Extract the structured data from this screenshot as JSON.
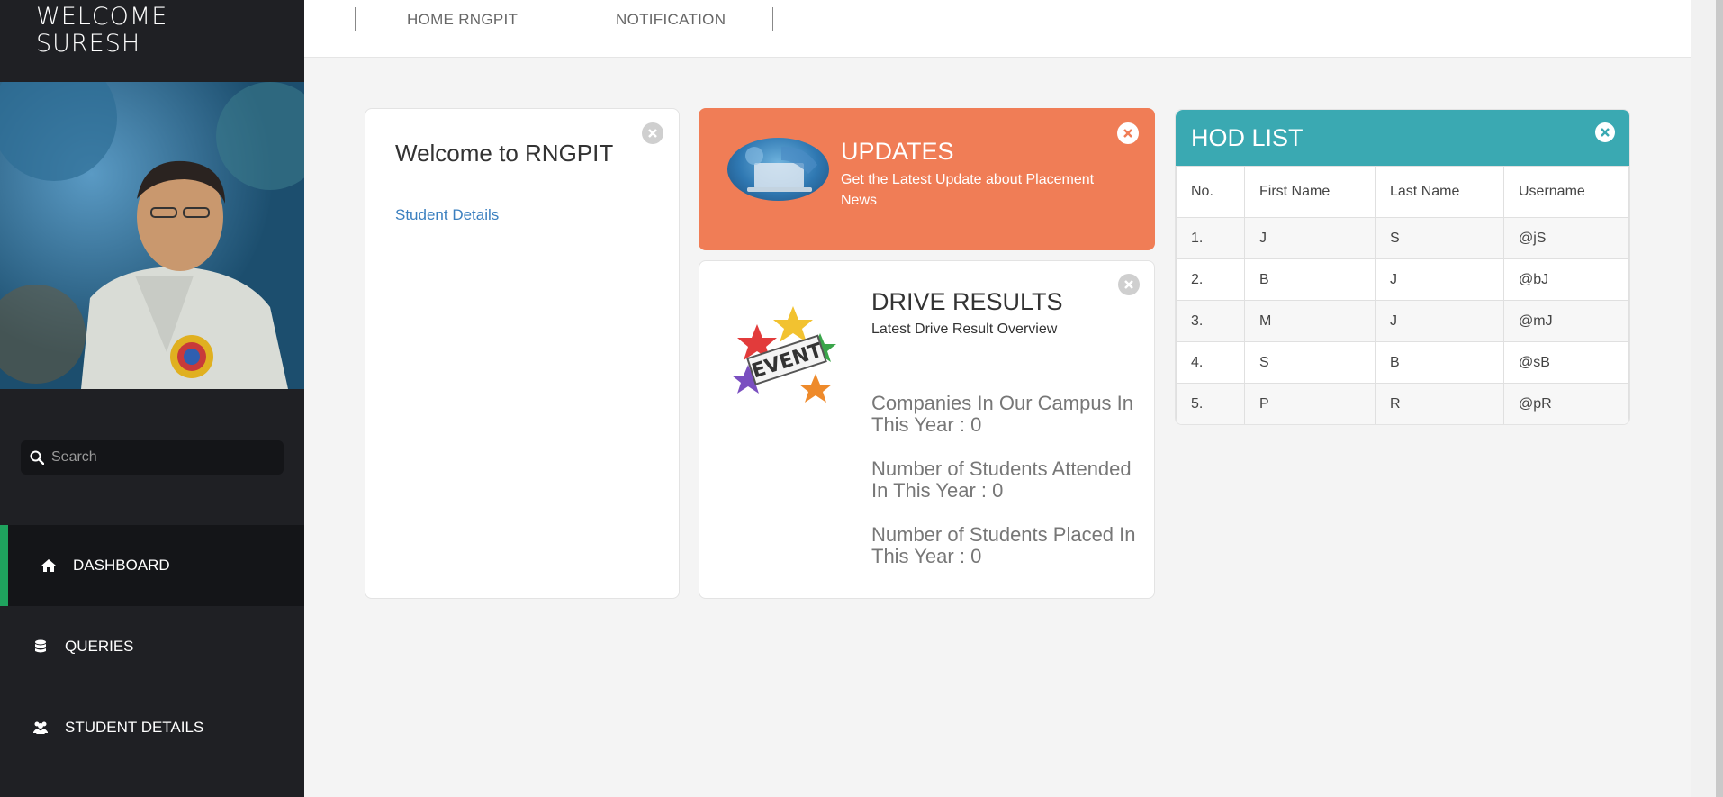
{
  "sidebar": {
    "welcome_line1": "WELCOME",
    "welcome_line2": "SURESH",
    "search": {
      "placeholder": "Search"
    },
    "nav": [
      {
        "label": "DASHBOARD",
        "icon": "home-icon",
        "active": true
      },
      {
        "label": "QUERIES",
        "icon": "database-icon",
        "active": false
      },
      {
        "label": "STUDENT DETAILS",
        "icon": "users-icon",
        "active": false
      }
    ]
  },
  "topbar": {
    "links": [
      "HOME RNGPIT",
      "NOTIFICATION"
    ]
  },
  "welcome_panel": {
    "title": "Welcome to RNGPIT",
    "link": "Student Details"
  },
  "updates_panel": {
    "title": "UPDATES",
    "subtitle": "Get the Latest Update about Placement News"
  },
  "drive_panel": {
    "title": "DRIVE RESULTS",
    "subtitle": "Latest Drive Result Overview",
    "stats": [
      "Companies In Our Campus In This Year : 0",
      "Number of Students Attended In This Year : 0",
      "Number of Students Placed In This Year : 0"
    ]
  },
  "hod_panel": {
    "title": "HOD LIST",
    "columns": [
      "No.",
      "First Name",
      "Last Name",
      "Username"
    ],
    "rows": [
      [
        "1.",
        "J",
        "S",
        "@jS"
      ],
      [
        "2.",
        "B",
        "J",
        "@bJ"
      ],
      [
        "3.",
        "M",
        "J",
        "@mJ"
      ],
      [
        "4.",
        "S",
        "B",
        "@sB"
      ],
      [
        "5.",
        "P",
        "R",
        "@pR"
      ]
    ]
  },
  "colors": {
    "sidebar_bg": "#1f2024",
    "active_accent": "#1fa35e",
    "updates_bg": "#f07d56",
    "hod_header_bg": "#3aa9b2",
    "link_blue": "#3a7fbf"
  }
}
